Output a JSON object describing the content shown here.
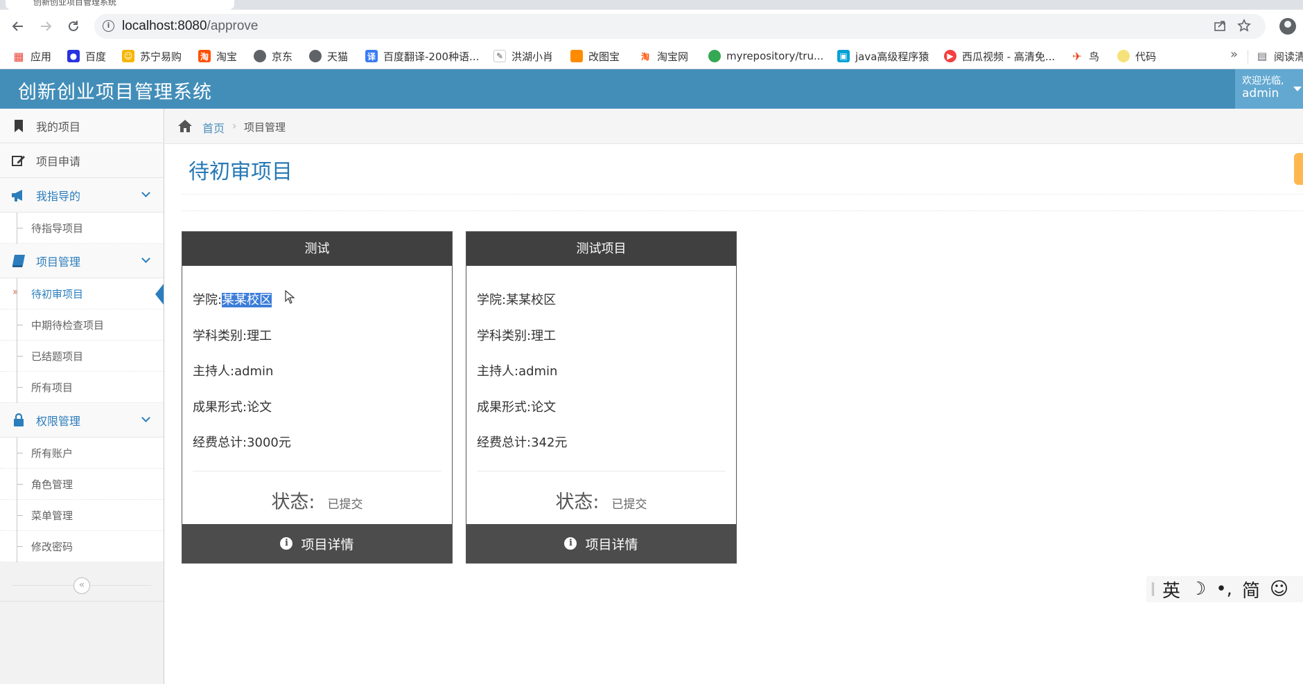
{
  "browser": {
    "tab_title": "创新创业项目管理系统",
    "url_host": "localhost:8080",
    "url_path": "/approve",
    "bookmarks": [
      {
        "label": "应用",
        "color": "#ea4335",
        "glyph": "▦"
      },
      {
        "label": "百度",
        "color": "#2932e1",
        "glyph": "🐾"
      },
      {
        "label": "苏宁易购",
        "color": "#f7b500",
        "glyph": "☺"
      },
      {
        "label": "淘宝",
        "color": "#ff5000",
        "glyph": "淘"
      },
      {
        "label": "京东",
        "color": "#5f6368",
        "glyph": "◍"
      },
      {
        "label": "天猫",
        "color": "#5f6368",
        "glyph": "◍"
      },
      {
        "label": "百度翻译-200种语...",
        "color": "#3b7cf5",
        "glyph": "译"
      },
      {
        "label": "洪湖小肖",
        "color": "#6a6a6a",
        "glyph": "✎"
      },
      {
        "label": "改图宝",
        "color": "#ff8c00",
        "glyph": "■"
      },
      {
        "label": "淘宝网",
        "color": "#ff5000",
        "glyph": "淘"
      },
      {
        "label": "myrepository/tru...",
        "color": "#34a853",
        "glyph": "●"
      },
      {
        "label": "java高级程序猿",
        "color": "#00a1d6",
        "glyph": "▣"
      },
      {
        "label": "西瓜视频 - 高清免...",
        "color": "#f43f3f",
        "glyph": "▶"
      },
      {
        "label": "鸟",
        "color": "#e84118",
        "glyph": "✈"
      },
      {
        "label": "代码",
        "color": "#f5e27a",
        "glyph": "◐"
      }
    ],
    "more": "»",
    "reading_list": "阅读清"
  },
  "header": {
    "title": "创新创业项目管理系统",
    "welcome": "欢迎光临,",
    "username": "admin"
  },
  "sidebar": {
    "my_projects": "我的项目",
    "apply": "项目申请",
    "guided": {
      "label": "我指导的",
      "items": [
        "待指导项目"
      ]
    },
    "management": {
      "label": "项目管理",
      "items": [
        "待初审项目",
        "中期待检查项目",
        "已结题项目",
        "所有项目"
      ]
    },
    "permissions": {
      "label": "权限管理",
      "items": [
        "所有账户",
        "角色管理",
        "菜单管理",
        "修改密码"
      ]
    },
    "collapse": "«"
  },
  "breadcrumb": {
    "home": "首页",
    "separator": "›",
    "current": "项目管理"
  },
  "page": {
    "title": "待初审项目"
  },
  "projects": [
    {
      "name": "测试",
      "college_label": "学院:",
      "college": "某某校区",
      "discipline": "学科类别:理工",
      "host": "主持人:admin",
      "result": "成果形式:论文",
      "funding": "经费总计:3000元",
      "status_label": "状态:",
      "status": "已提交",
      "detail_button": "项目详情"
    },
    {
      "name": "测试项目",
      "college_label": "学院:",
      "college": "某某校区",
      "discipline": "学科类别:理工",
      "host": "主持人:admin",
      "result": "成果形式:论文",
      "funding": "经费总计:342元",
      "status_label": "状态:",
      "status": "已提交",
      "detail_button": "项目详情"
    }
  ],
  "ime": [
    "英",
    "☽",
    "•,",
    "简",
    "☺"
  ],
  "colors": {
    "header_bg": "#438eb9",
    "link_blue": "#2b7dbc",
    "card_head": "#404040",
    "card_foot": "#4c4c4c"
  }
}
